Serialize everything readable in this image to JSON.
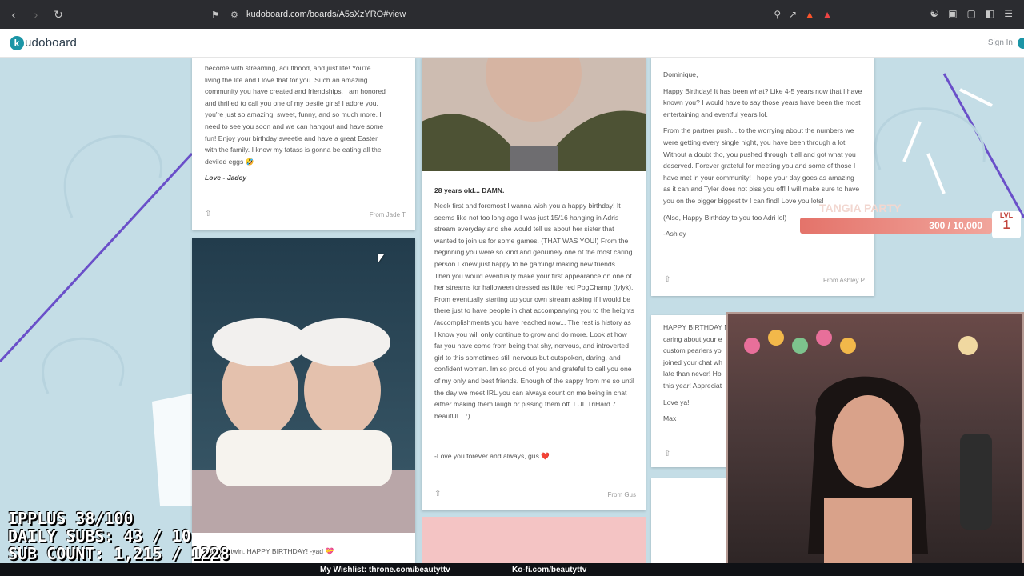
{
  "browser": {
    "url": "kudoboard.com/boards/A5sXzYRO#view",
    "back_icon": "chevron-left-icon",
    "forward_icon": "chevron-right-icon",
    "reload_icon": "reload-icon"
  },
  "header": {
    "logo_k": "k",
    "logo_rest": "udoboard",
    "signin": "Sign In"
  },
  "cards": {
    "jade": {
      "lines": [
        "become with streaming, adulthood, and just life! You're",
        "living the life and I love that for you. Such an amazing",
        "community you have created and friendships. I am honored",
        "and thrilled to call you one of my bestie girls! I adore you,",
        "you're just so amazing, sweet, funny, and so much more. I",
        "need to see you soon and we can hangout and have some",
        "fun! Enjoy your birthday sweetie and have a great Easter",
        "with the family. I know my fatass is gonna be eating all the",
        "deviled eggs 🤣"
      ],
      "sign": "Love - Jadey",
      "from": "From Jade T"
    },
    "twins": {
      "caption": "Love ya twin, HAPPY BIRTHDAY! -yad 💝"
    },
    "gus": {
      "title": "28 years old... DAMN.",
      "body": "Neek first and foremost I wanna wish you a happy birthday! It seems like not too long ago I was just 15/16 hanging in Adris stream everyday and she would tell us about her sister that wanted to join us for some games. (THAT WAS YOU!) From the beginning you were so kind and genuinely one of the most caring person I knew just happy to be gaming/ making new friends. Then you would eventually make your first appearance on one of her streams for halloween dressed as little red PogChamp (lylyk). From eventually starting up your own stream asking if I would be there just to have people in chat accompanying you to the heights /accomplishments you have reached now... The rest is history as I know you will only continue to grow and do more. Look at how far you have come from being that shy, nervous, and introverted girl to this sometimes still nervous but outspoken, daring, and confident woman. Im so proud of you and grateful to call you one of my only and best friends. Enough of the sappy from me so until the day we meet IRL you can always count on me being in chat either making them laugh or pissing them off. LUL TriHard 7 beautULT :)",
      "sign": "-Love you forever and always, gus ❤️",
      "from": "From Gus"
    },
    "ashley": {
      "greeting": "Dominique,",
      "p1": "Happy Birthday! It has been what? Like 4-5 years now that I have known you? I would have to say those years have been the most entertaining and eventful years lol.",
      "p2": "From the partner push... to the worrying about the numbers we were getting every single night, you have been through a lot! Without a doubt tho, you pushed through it all and got what you deserved. Forever grateful for meeting you and some of those I have met in your community! I hope your day goes as amazing as it can and Tyler does not piss you off! I will make sure to have you on the bigger biggest tv I can find! Love you lots!",
      "p3": "(Also, Happy Birthday to you too Adri lol)",
      "sign": "-Ashley",
      "from": "From Ashley P"
    },
    "max": {
      "lines": [
        "HAPPY BIRTHDAY N",
        "caring about your e",
        "custom pearlers yo",
        "joined your chat wh",
        "late than never! Ho",
        "this year! Appreciat"
      ],
      "sign1": "Love ya!",
      "sign2": "Max"
    }
  },
  "overlay": {
    "line1": "IPPLUS 38/100",
    "line2": "DAILY SUBS: 43 / 10",
    "line3": "SUB COUNT: 1,215 / 1228",
    "wishlist": "My Wishlist: throne.com/beautyttv",
    "kofi": "Ko-fi.com/beautyttv",
    "party_title": "TANGIA PARTY",
    "party_progress": "300 / 10,000",
    "party_fraction": 0.03,
    "lvl_label": "LVL",
    "lvl_value": "1"
  }
}
